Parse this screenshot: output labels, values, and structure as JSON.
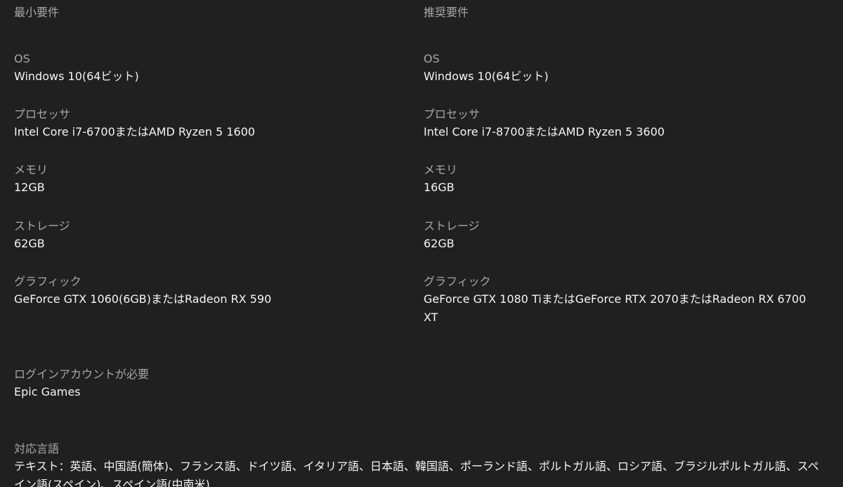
{
  "minimum": {
    "title": "最小要件",
    "specs": [
      {
        "label": "OS",
        "value": "Windows 10(64ビット)"
      },
      {
        "label": "プロセッサ",
        "value": "Intel Core i7-6700またはAMD Ryzen 5 1600"
      },
      {
        "label": "メモリ",
        "value": "12GB"
      },
      {
        "label": "ストレージ",
        "value": "62GB"
      },
      {
        "label": "グラフィック",
        "value": "GeForce GTX 1060(6GB)またはRadeon RX 590"
      }
    ]
  },
  "recommended": {
    "title": "推奨要件",
    "specs": [
      {
        "label": "OS",
        "value": "Windows 10(64ビット)"
      },
      {
        "label": "プロセッサ",
        "value": "Intel Core i7-8700またはAMD Ryzen 5 3600"
      },
      {
        "label": "メモリ",
        "value": "16GB"
      },
      {
        "label": "ストレージ",
        "value": "62GB"
      },
      {
        "label": "グラフィック",
        "value": "GeForce GTX 1080 TiまたはGeForce RTX 2070またはRadeon RX 6700 XT"
      }
    ]
  },
  "login": {
    "label": "ログインアカウントが必要",
    "value": "Epic Games"
  },
  "languages": {
    "label": "対応言語",
    "text": "テキスト：英語、中国語(簡体)、フランス語、ドイツ語、イタリア語、日本語、韓国語、ポーランド語、ポルトガル語、ロシア語、ブラジルポルトガル語、スペイン語(スペイン)、スペイン語(中南米)"
  }
}
